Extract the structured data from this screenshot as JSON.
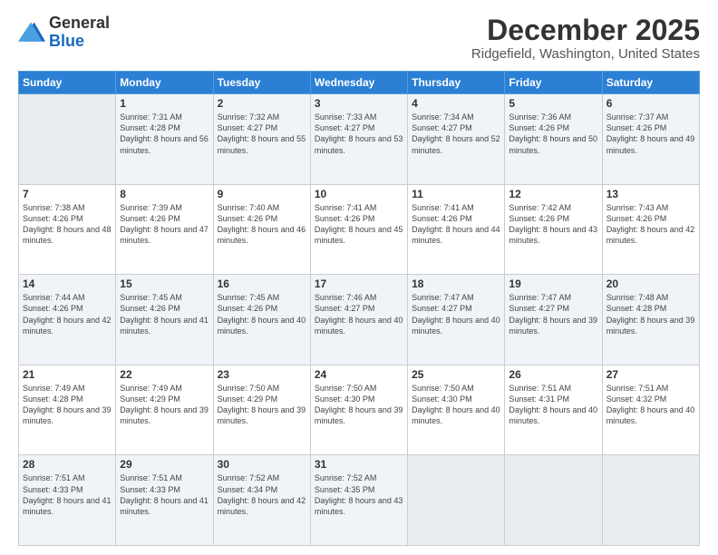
{
  "header": {
    "logo_general": "General",
    "logo_blue": "Blue",
    "month_title": "December 2025",
    "location": "Ridgefield, Washington, United States"
  },
  "weekdays": [
    "Sunday",
    "Monday",
    "Tuesday",
    "Wednesday",
    "Thursday",
    "Friday",
    "Saturday"
  ],
  "weeks": [
    [
      {
        "day": "",
        "empty": true
      },
      {
        "day": "1",
        "sunrise": "7:31 AM",
        "sunset": "4:28 PM",
        "daylight": "8 hours and 56 minutes."
      },
      {
        "day": "2",
        "sunrise": "7:32 AM",
        "sunset": "4:27 PM",
        "daylight": "8 hours and 55 minutes."
      },
      {
        "day": "3",
        "sunrise": "7:33 AM",
        "sunset": "4:27 PM",
        "daylight": "8 hours and 53 minutes."
      },
      {
        "day": "4",
        "sunrise": "7:34 AM",
        "sunset": "4:27 PM",
        "daylight": "8 hours and 52 minutes."
      },
      {
        "day": "5",
        "sunrise": "7:36 AM",
        "sunset": "4:26 PM",
        "daylight": "8 hours and 50 minutes."
      },
      {
        "day": "6",
        "sunrise": "7:37 AM",
        "sunset": "4:26 PM",
        "daylight": "8 hours and 49 minutes."
      }
    ],
    [
      {
        "day": "7",
        "sunrise": "7:38 AM",
        "sunset": "4:26 PM",
        "daylight": "8 hours and 48 minutes."
      },
      {
        "day": "8",
        "sunrise": "7:39 AM",
        "sunset": "4:26 PM",
        "daylight": "8 hours and 47 minutes."
      },
      {
        "day": "9",
        "sunrise": "7:40 AM",
        "sunset": "4:26 PM",
        "daylight": "8 hours and 46 minutes."
      },
      {
        "day": "10",
        "sunrise": "7:41 AM",
        "sunset": "4:26 PM",
        "daylight": "8 hours and 45 minutes."
      },
      {
        "day": "11",
        "sunrise": "7:41 AM",
        "sunset": "4:26 PM",
        "daylight": "8 hours and 44 minutes."
      },
      {
        "day": "12",
        "sunrise": "7:42 AM",
        "sunset": "4:26 PM",
        "daylight": "8 hours and 43 minutes."
      },
      {
        "day": "13",
        "sunrise": "7:43 AM",
        "sunset": "4:26 PM",
        "daylight": "8 hours and 42 minutes."
      }
    ],
    [
      {
        "day": "14",
        "sunrise": "7:44 AM",
        "sunset": "4:26 PM",
        "daylight": "8 hours and 42 minutes."
      },
      {
        "day": "15",
        "sunrise": "7:45 AM",
        "sunset": "4:26 PM",
        "daylight": "8 hours and 41 minutes."
      },
      {
        "day": "16",
        "sunrise": "7:45 AM",
        "sunset": "4:26 PM",
        "daylight": "8 hours and 40 minutes."
      },
      {
        "day": "17",
        "sunrise": "7:46 AM",
        "sunset": "4:27 PM",
        "daylight": "8 hours and 40 minutes."
      },
      {
        "day": "18",
        "sunrise": "7:47 AM",
        "sunset": "4:27 PM",
        "daylight": "8 hours and 40 minutes."
      },
      {
        "day": "19",
        "sunrise": "7:47 AM",
        "sunset": "4:27 PM",
        "daylight": "8 hours and 39 minutes."
      },
      {
        "day": "20",
        "sunrise": "7:48 AM",
        "sunset": "4:28 PM",
        "daylight": "8 hours and 39 minutes."
      }
    ],
    [
      {
        "day": "21",
        "sunrise": "7:49 AM",
        "sunset": "4:28 PM",
        "daylight": "8 hours and 39 minutes."
      },
      {
        "day": "22",
        "sunrise": "7:49 AM",
        "sunset": "4:29 PM",
        "daylight": "8 hours and 39 minutes."
      },
      {
        "day": "23",
        "sunrise": "7:50 AM",
        "sunset": "4:29 PM",
        "daylight": "8 hours and 39 minutes."
      },
      {
        "day": "24",
        "sunrise": "7:50 AM",
        "sunset": "4:30 PM",
        "daylight": "8 hours and 39 minutes."
      },
      {
        "day": "25",
        "sunrise": "7:50 AM",
        "sunset": "4:30 PM",
        "daylight": "8 hours and 40 minutes."
      },
      {
        "day": "26",
        "sunrise": "7:51 AM",
        "sunset": "4:31 PM",
        "daylight": "8 hours and 40 minutes."
      },
      {
        "day": "27",
        "sunrise": "7:51 AM",
        "sunset": "4:32 PM",
        "daylight": "8 hours and 40 minutes."
      }
    ],
    [
      {
        "day": "28",
        "sunrise": "7:51 AM",
        "sunset": "4:33 PM",
        "daylight": "8 hours and 41 minutes."
      },
      {
        "day": "29",
        "sunrise": "7:51 AM",
        "sunset": "4:33 PM",
        "daylight": "8 hours and 41 minutes."
      },
      {
        "day": "30",
        "sunrise": "7:52 AM",
        "sunset": "4:34 PM",
        "daylight": "8 hours and 42 minutes."
      },
      {
        "day": "31",
        "sunrise": "7:52 AM",
        "sunset": "4:35 PM",
        "daylight": "8 hours and 43 minutes."
      },
      {
        "day": "",
        "empty": true
      },
      {
        "day": "",
        "empty": true
      },
      {
        "day": "",
        "empty": true
      }
    ]
  ]
}
